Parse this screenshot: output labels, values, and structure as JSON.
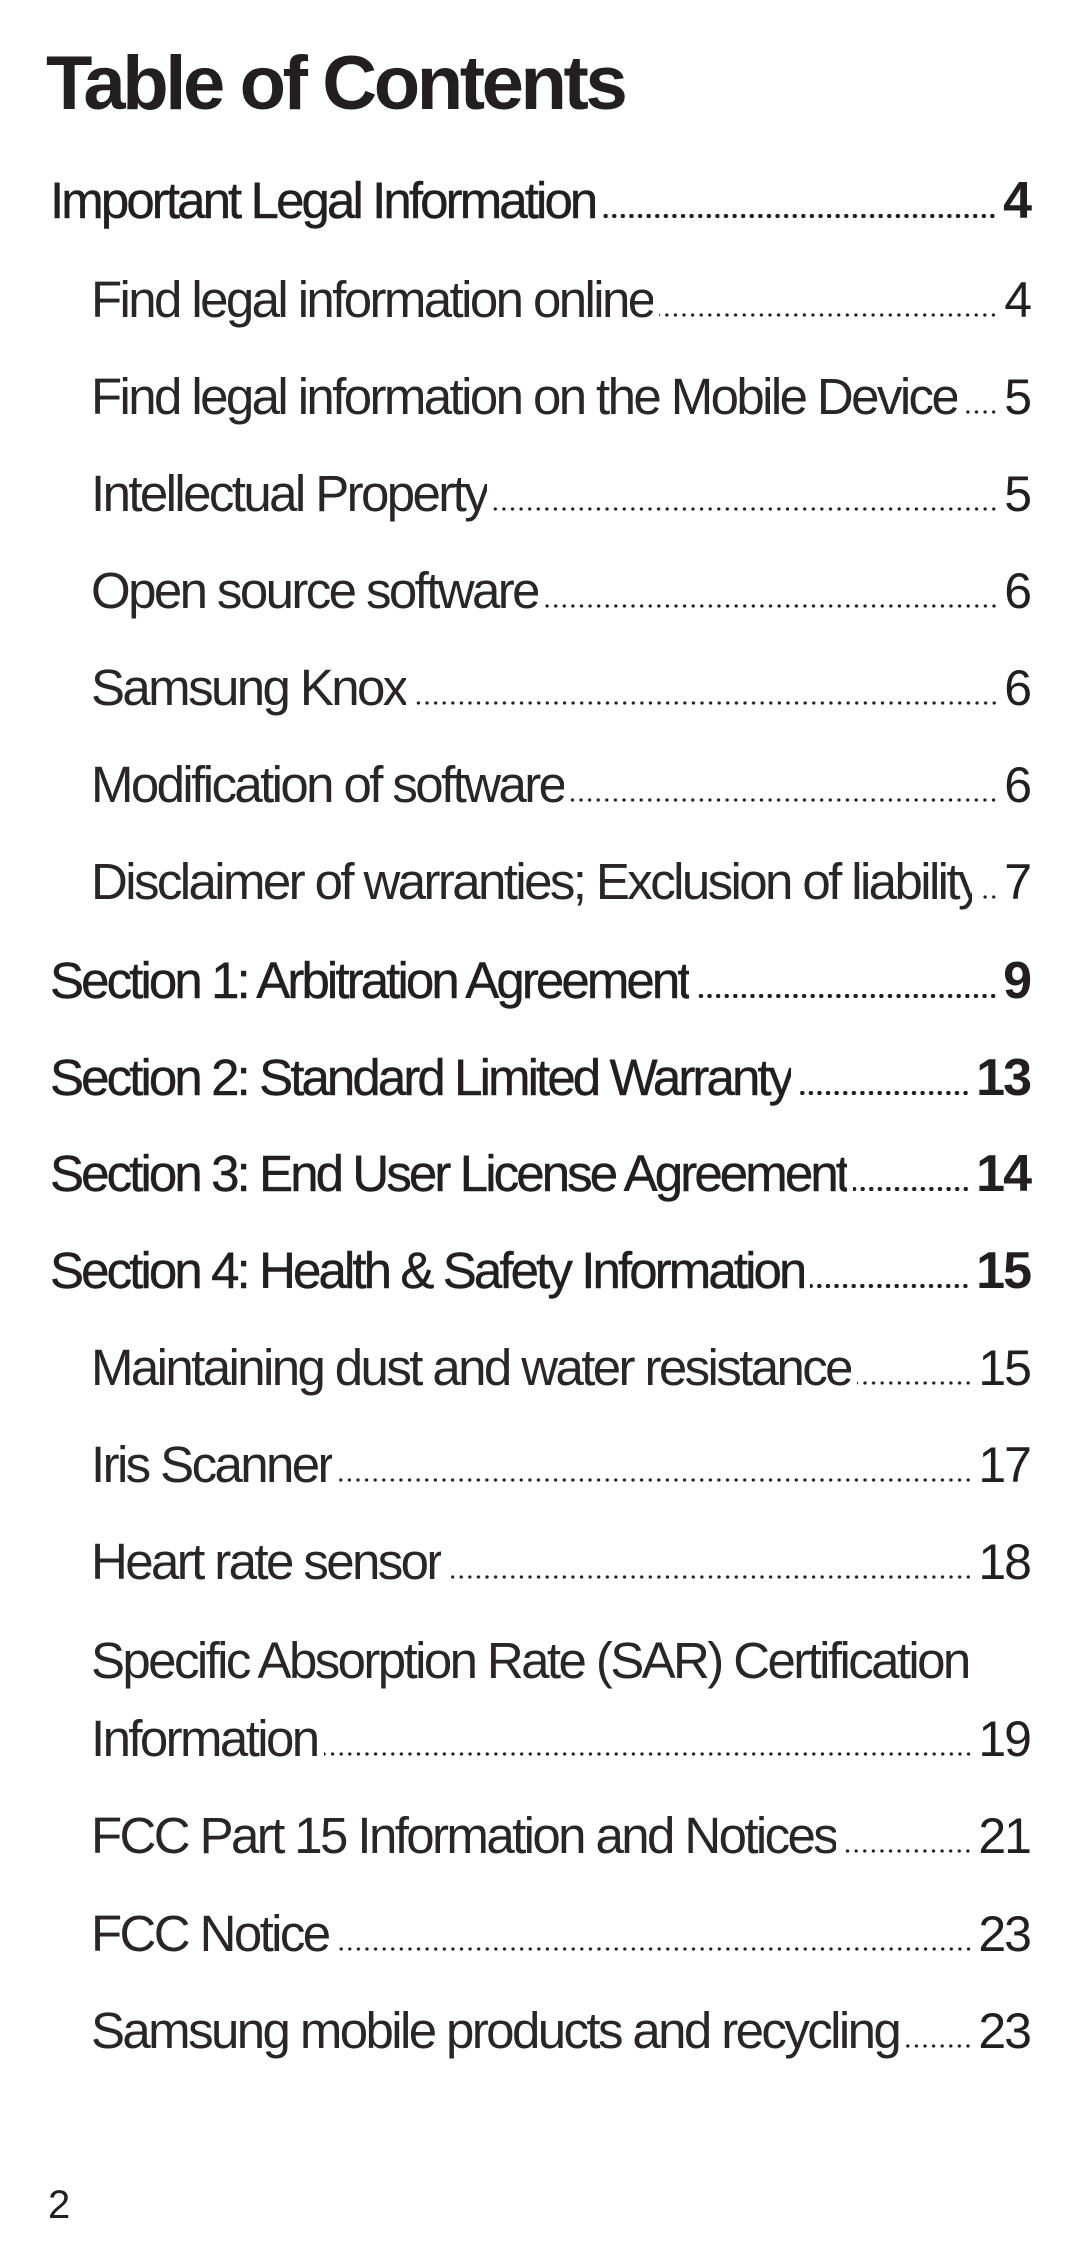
{
  "document": {
    "title": "Table of Contents",
    "page_number": "2"
  },
  "toc": {
    "entries": [
      {
        "label": "Important Legal Information",
        "page": "4",
        "level": 1
      },
      {
        "label": "Find legal information online",
        "page": "4",
        "level": 2
      },
      {
        "label": "Find legal information on the Mobile Device",
        "page": "5",
        "level": 2
      },
      {
        "label": "Intellectual Property",
        "page": "5",
        "level": 2
      },
      {
        "label": "Open source software",
        "page": "6",
        "level": 2
      },
      {
        "label": "Samsung Knox",
        "page": "6",
        "level": 2
      },
      {
        "label": "Modification of software",
        "page": "6",
        "level": 2
      },
      {
        "label": "Disclaimer of warranties; Exclusion of liability",
        "page": "7",
        "level": 2
      },
      {
        "label": "Section 1: Arbitration Agreement",
        "page": "9",
        "level": 1
      },
      {
        "label": "Section 2: Standard Limited Warranty",
        "page": "13",
        "level": 1
      },
      {
        "label": "Section 3: End User License Agreement",
        "page": "14",
        "level": 1
      },
      {
        "label": "Section 4: Health & Safety Information",
        "page": "15",
        "level": 1
      },
      {
        "label": "Maintaining dust and water resistance",
        "page": "15",
        "level": 2
      },
      {
        "label": "Iris Scanner",
        "page": "17",
        "level": 2
      },
      {
        "label": "Heart rate sensor",
        "page": "18",
        "level": 2
      },
      {
        "label": "Specific Absorption Rate (SAR) Certification Information",
        "label_line_1": "Specific Absorption Rate (SAR) Certification",
        "label_line_2": "Information",
        "page": "19",
        "level": 2
      },
      {
        "label": "FCC Part 15 Information and Notices",
        "page": "21",
        "level": 2
      },
      {
        "label": "FCC Notice",
        "page": "23",
        "level": 2
      },
      {
        "label": "Samsung mobile products and recycling",
        "page": "23",
        "level": 2
      }
    ]
  }
}
